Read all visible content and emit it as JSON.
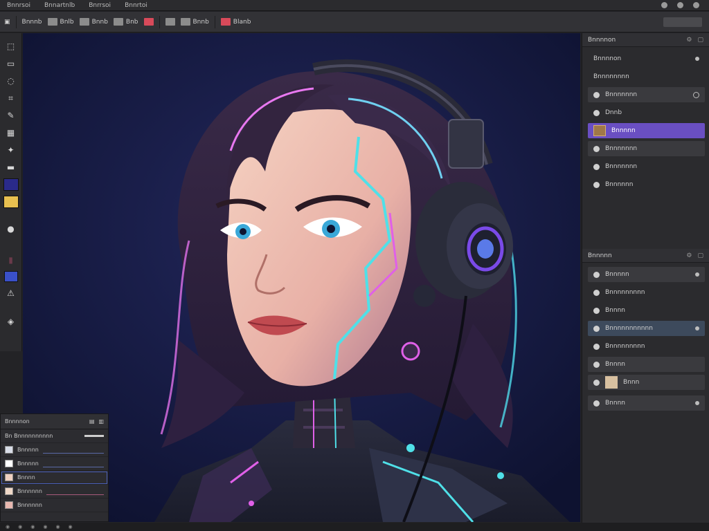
{
  "menubar": {
    "items": [
      "Bnnrsoi",
      "Bnnartnlb",
      "Bnrrsoi",
      "Bnnrtoi"
    ]
  },
  "options": {
    "items": [
      "Bnnnb",
      "Bnlb",
      "Bnnb",
      "Bnb",
      "Bnb",
      "Bnb",
      "Bnnb",
      "Blanb"
    ]
  },
  "layers_panel": {
    "title": "Bnnnnon",
    "sub_header_1": "Bnnnnon",
    "sub_header_2": "Bnnnnnnnn",
    "items": [
      {
        "label": "Bnnnnnnn",
        "state": "normal"
      },
      {
        "label": "Dnnb",
        "state": "flat"
      },
      {
        "label": "Bnnnnn",
        "state": "selected"
      },
      {
        "label": "Bnnnnnnn",
        "state": "normal"
      },
      {
        "label": "Bnnnnnnn",
        "state": "flat"
      },
      {
        "label": "Bnnnnnn",
        "state": "flat"
      }
    ]
  },
  "adjust_panel": {
    "title": "Bnnnnn",
    "items": [
      {
        "label": "Bnnnnn",
        "state": "normal"
      },
      {
        "label": "Bnnnnnnnnn",
        "state": "flat"
      },
      {
        "label": "Bnnnn",
        "state": "flat"
      },
      {
        "label": "Bnnnnnnnnnnn",
        "state": "selected"
      },
      {
        "label": "Bnnnnnnnnn",
        "state": "flat"
      },
      {
        "label": "Bnnnn",
        "state": "normal"
      },
      {
        "label": "Bnnn",
        "state": "thumb"
      },
      {
        "label": "Bnnnn",
        "state": "normal"
      }
    ]
  },
  "float_panel": {
    "title": "Bnnnnon",
    "rows": [
      "Bn Bnnnnnnnnnn",
      "Bnnnnn",
      "Bnnnnn",
      "Bnnnn",
      "Bnnnnnn",
      "Bnnnnnn"
    ]
  },
  "colors": {
    "foreground": "#2a2a8a",
    "background": "#e8c050",
    "accent": "#6a4fc2"
  },
  "icons": [
    "move-icon",
    "marquee-icon",
    "lasso-icon",
    "crop-icon",
    "brush-icon",
    "eraser-icon",
    "smudge-icon",
    "zoom-icon"
  ]
}
